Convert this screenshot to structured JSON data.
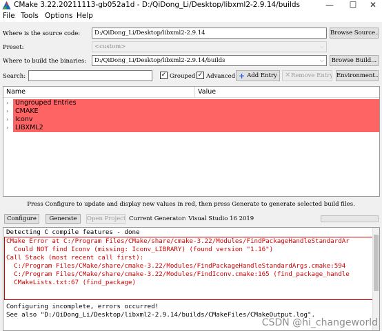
{
  "window": {
    "title": "CMake 3.22.20211113-gb052a1d - D:/QiDong_Li/Desktop/libxml2-2.9.14/builds",
    "controls": {
      "minimize": "—",
      "maximize": "☐",
      "close": "✕"
    }
  },
  "menu": [
    "File",
    "Tools",
    "Options",
    "Help"
  ],
  "source": {
    "label": "Where is the source code:",
    "value": "D:/QiDong_Li/Desktop/libxml2-2.9.14",
    "button": "Browse Source..."
  },
  "preset": {
    "label": "Preset:",
    "value": "<custom>"
  },
  "binary": {
    "label": "Where to build the binaries:",
    "value": "D:/QiDong_Li/Desktop/libxml2-2.9.14/builds",
    "button": "Browse Build..."
  },
  "search": {
    "label": "Search:",
    "value": "",
    "grouped_label": "Grouped",
    "grouped_checked": "✓",
    "advanced_label": "Advanced",
    "advanced_checked": "✓",
    "add_entry": "Add Entry",
    "remove_entry": "Remove Entry",
    "environment": "Environment..."
  },
  "table": {
    "columns": [
      "Name",
      "Value"
    ],
    "rows": [
      "Ungrouped Entries",
      "CMAKE",
      "Iconv",
      "LIBXML2"
    ],
    "row_color": "#ff6464"
  },
  "hint": "Press Configure to update and display new values in red, then press Generate to generate selected build files.",
  "actions": {
    "configure": "Configure",
    "generate": "Generate",
    "open_project": "Open Project",
    "generator": "Current Generator: Visual Studio 16 2019"
  },
  "log": {
    "lines": [
      "Detecting C compile features - done",
      "CMake Error at C:/Program Files/CMake/share/cmake-3.22/Modules/FindPackageHandleStandardAr",
      "  Could NOT find Iconv (missing: Iconv_LIBRARY) (found version \"1.16\")",
      "Call Stack (most recent call first):",
      "  C:/Program Files/CMake/share/cmake-3.22/Modules/FindPackageHandleStandardArgs.cmake:594",
      "  C:/Program Files/CMake/share/cmake-3.22/Modules/FindIconv.cmake:165 (find_package_handle",
      "  CMakeLists.txt:67 (find_package)",
      "",
      "",
      "Configuring incomplete, errors occurred!",
      "See also \"D:/QiDong_Li/Desktop/libxml2-2.9.14/builds/CMakeFiles/CMakeOutput.log\"."
    ],
    "error_color": "#d10000"
  },
  "watermark": "CSDN @hi_changeworld"
}
